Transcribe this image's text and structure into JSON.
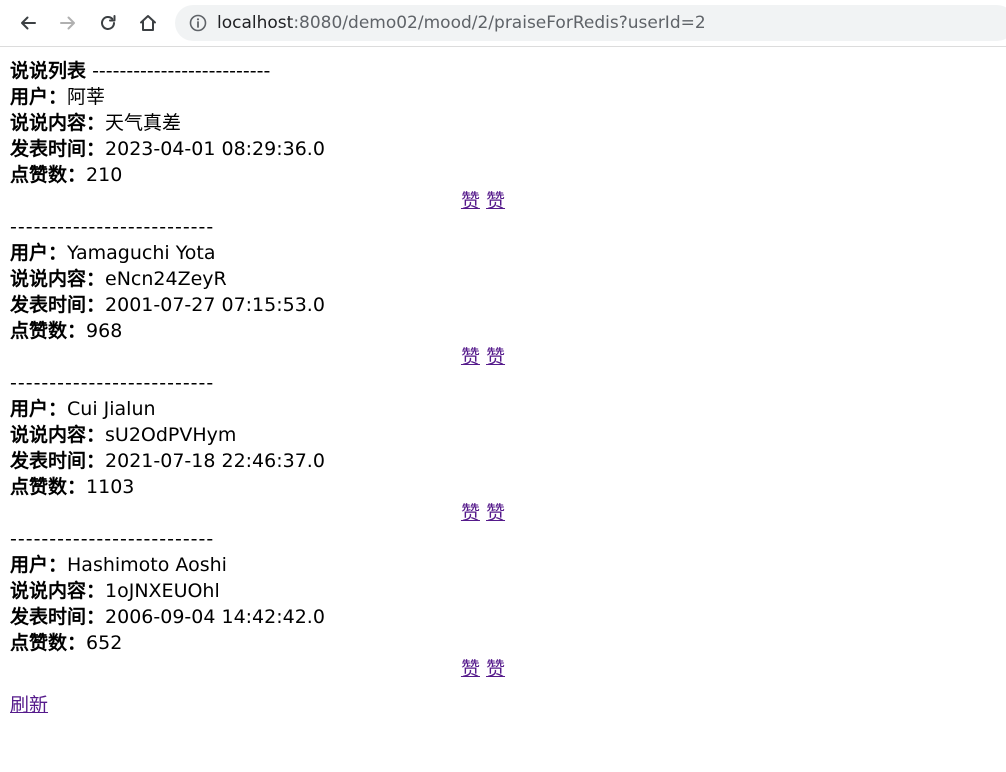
{
  "browser": {
    "url_host": "localhost",
    "url_rest": ":8080/demo02/mood/2/praiseForRedis?userId=2"
  },
  "page": {
    "heading": "说说列表",
    "separator": "--------------------------",
    "labels": {
      "user": "用户：",
      "content": "说说内容：",
      "time": "发表时间：",
      "likes": "点赞数："
    },
    "like_label_1": "赞",
    "like_label_2": "赞",
    "refresh_label": "刷新"
  },
  "moods": [
    {
      "user": "阿莘",
      "content": "天气真差",
      "time": "2023-04-01 08:29:36.0",
      "likes": "210"
    },
    {
      "user": "Yamaguchi Yota",
      "content": "eNcn24ZeyR",
      "time": "2001-07-27 07:15:53.0",
      "likes": "968"
    },
    {
      "user": "Cui Jialun",
      "content": "sU2OdPVHym",
      "time": "2021-07-18 22:46:37.0",
      "likes": "1103"
    },
    {
      "user": "Hashimoto Aoshi",
      "content": "1oJNXEUOhl",
      "time": "2006-09-04 14:42:42.0",
      "likes": "652"
    }
  ]
}
